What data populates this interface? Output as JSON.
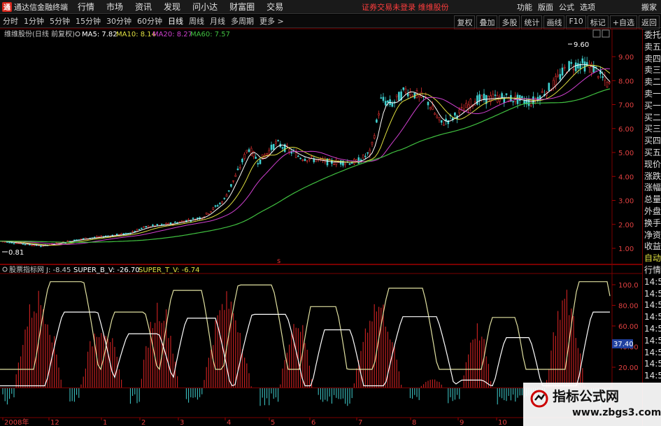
{
  "menubar": {
    "logo_glyph": "通",
    "app_name": "通达信金融终端",
    "items": [
      "行情",
      "市场",
      "资讯",
      "发现",
      "问小达",
      "财富圈",
      "交易"
    ],
    "notice": "证券交易未登录  维维股份",
    "right_items": [
      "功能",
      "版面",
      "公式",
      "选项",
      "搬家"
    ]
  },
  "toolbar": {
    "periods": [
      "分时",
      "1分钟",
      "5分钟",
      "15分钟",
      "30分钟",
      "60分钟",
      "日线",
      "周线",
      "月线",
      "多周期",
      "更多 >"
    ],
    "active_period": "日线",
    "right_buttons": [
      "复权",
      "叠加",
      "多股",
      "统计",
      "画线",
      "F10",
      "标记",
      "+自选",
      "返回"
    ]
  },
  "main_chart": {
    "stock_title": "维维股份(日线 前复权)",
    "ma": [
      {
        "label": "MA5: 7.82",
        "color": "#ffffff"
      },
      {
        "label": "MA10: 8.14",
        "color": "#e0e040"
      },
      {
        "label": "MA20: 8.27",
        "color": "#d040d0"
      },
      {
        "label": "MA60: 7.57",
        "color": "#40c040"
      }
    ],
    "price_ticks": [
      "9.00",
      "8.00",
      "7.00",
      "6.00",
      "5.00",
      "4.00",
      "3.00",
      "2.00",
      "1.00"
    ],
    "high_label": "9.60",
    "low_label": "0.81"
  },
  "indicator": {
    "title": "股票指标网",
    "items": [
      {
        "label": "J: -8.45",
        "color": "#c8c8c8"
      },
      {
        "label": "SUPER_B_V: -26.70",
        "color": "#ffffff"
      },
      {
        "label": "SUPER_T_V: -6.74",
        "color": "#e0e040"
      }
    ],
    "ticks": [
      "100.0",
      "80.00",
      "60.00",
      "40.00",
      "20.00"
    ],
    "current_value": "37.40"
  },
  "time_axis": {
    "labels": [
      "2008年",
      "12",
      "1",
      "2",
      "3",
      "4",
      "5",
      "6",
      "7",
      "8",
      "9",
      "10"
    ]
  },
  "side_panel": {
    "items": [
      "委托",
      "卖五",
      "卖四",
      "卖三",
      "卖二",
      "卖一",
      "买一",
      "买二",
      "买三",
      "买四",
      "买五",
      "现价",
      "涨跌",
      "涨幅",
      "总量",
      "外盘",
      "换手",
      "净资",
      "收益"
    ],
    "auto_label": "自动",
    "list_header": "行情",
    "times": [
      "14:55",
      "14:55",
      "14:55",
      "14:55",
      "14:55",
      "14:56",
      "14:56",
      "14:56",
      "14:56"
    ]
  },
  "watermark": {
    "title": "指标公式网",
    "url": "www.zbgs3.com"
  },
  "colors": {
    "up": "#e03030",
    "down": "#40d0d0",
    "ma5": "#ffffff",
    "ma10": "#e0e040",
    "ma20": "#d040d0",
    "ma60": "#40c040",
    "grid": "#7a0000"
  }
}
